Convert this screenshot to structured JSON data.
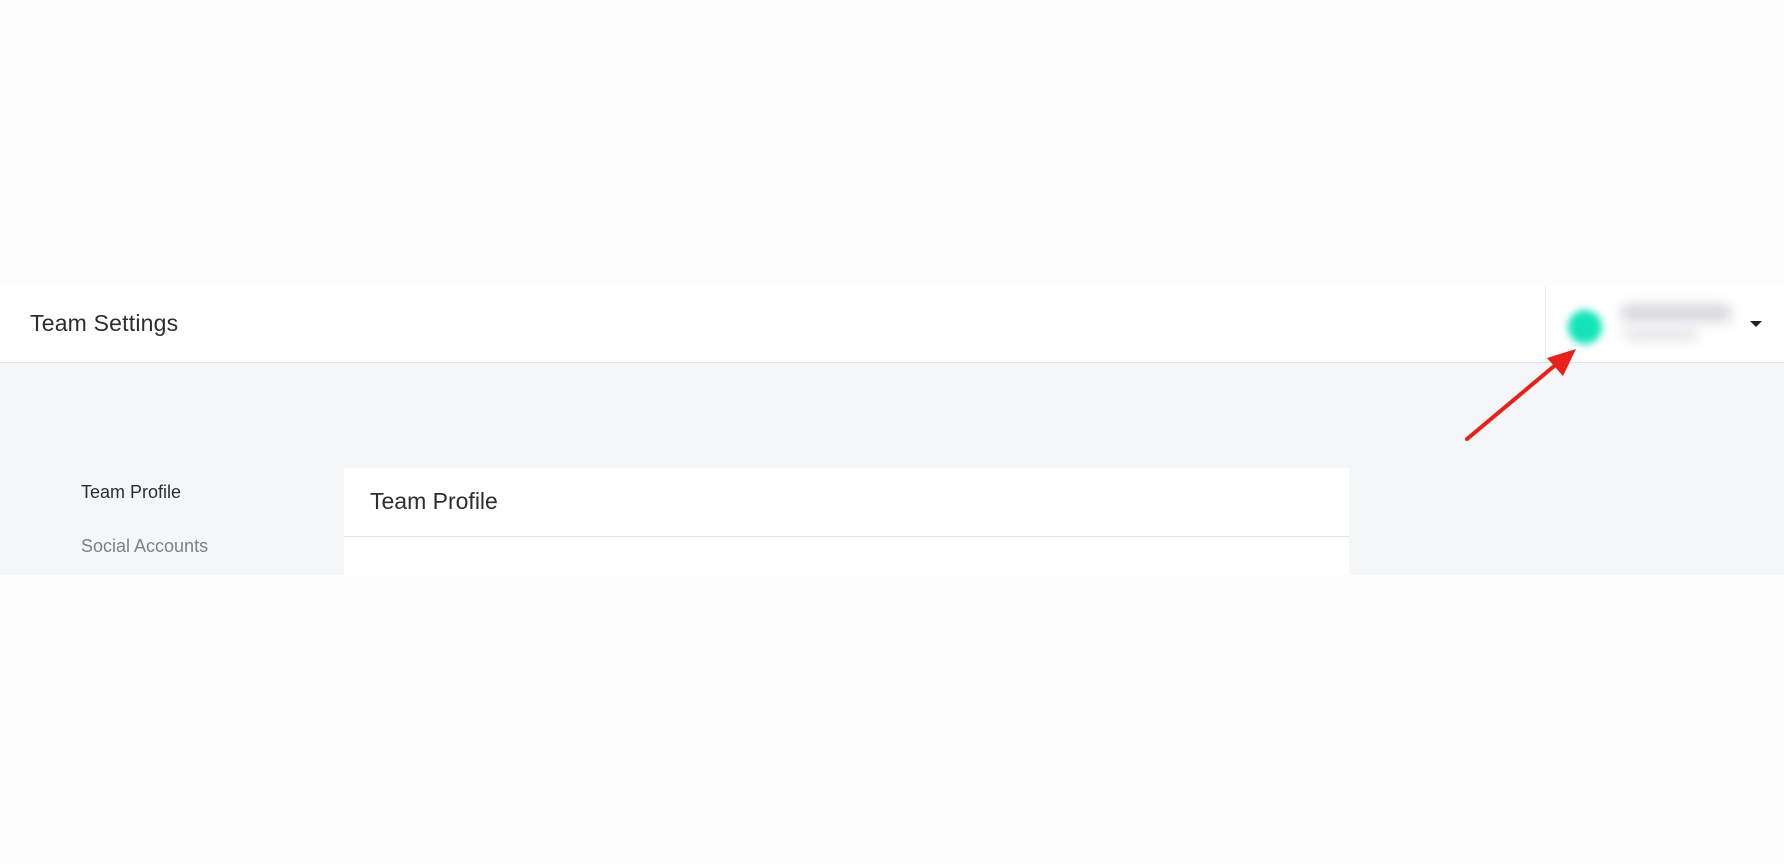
{
  "header": {
    "title": "Team Settings"
  },
  "account_menu": {
    "avatar_icon": "avatar-icon",
    "chevron_icon": "caret-down-icon",
    "avatar_color": "#12e3b8"
  },
  "sidebar": {
    "items": [
      {
        "label": "Team Profile",
        "active": true
      },
      {
        "label": "Social Accounts",
        "active": false
      }
    ]
  },
  "main": {
    "card_title": "Team Profile"
  },
  "annotation": {
    "arrow_color": "#e8201a",
    "points_to": "account-menu"
  }
}
